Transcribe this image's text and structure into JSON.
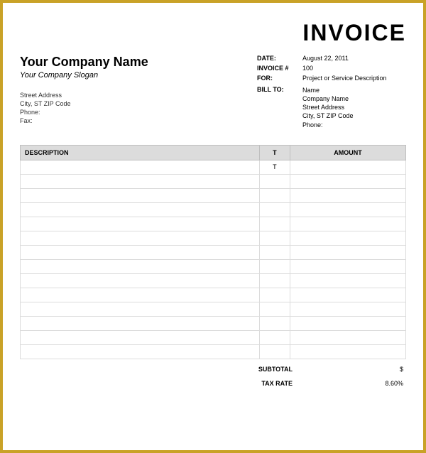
{
  "title": "INVOICE",
  "company": {
    "name": "Your Company Name",
    "slogan": "Your Company Slogan",
    "address_line1": "Street Address",
    "address_line2": "City, ST  ZIP Code",
    "phone_label": "Phone:",
    "fax_label": "Fax:"
  },
  "meta": {
    "date_label": "DATE:",
    "date_value": "August 22, 2011",
    "invoice_num_label": "INVOICE #",
    "invoice_num_value": "100",
    "for_label": "FOR:",
    "for_value": "Project or Service Description",
    "billto_label": "BILL TO:",
    "billto": {
      "name": "Name",
      "company": "Company Name",
      "street": "Street Address",
      "citystzip": "City, ST  ZIP Code",
      "phone_label": "Phone:"
    }
  },
  "table": {
    "header_description": "DESCRIPTION",
    "header_t": "T",
    "header_amount": "AMOUNT",
    "first_row_t": "T"
  },
  "footer": {
    "subtotal_label": "SUBTOTAL",
    "subtotal_value": "$",
    "taxrate_label": "TAX RATE",
    "taxrate_value": "8.60%"
  }
}
